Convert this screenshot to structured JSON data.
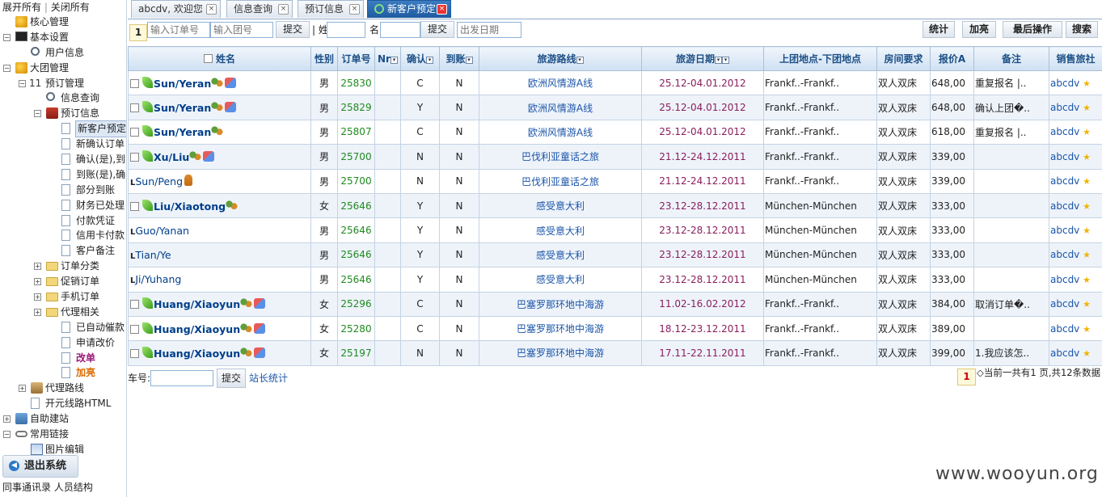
{
  "sidebar": {
    "expand_all": "展开所有",
    "collapse_all": "关闭所有",
    "tree": [
      {
        "label": "核心管理",
        "level": 0,
        "toggle": "",
        "icon": "globe-icon"
      },
      {
        "label": "基本设置",
        "level": 0,
        "toggle": "−",
        "icon": "monitor-icon"
      },
      {
        "label": "用户信息",
        "level": 1,
        "toggle": "",
        "icon": "search-icon"
      },
      {
        "label": "大团管理",
        "level": 0,
        "toggle": "−",
        "icon": "chart-icon"
      },
      {
        "label": "预订管理",
        "level": 1,
        "toggle": "−",
        "icon": "number-icon",
        "prefix": "11"
      },
      {
        "label": "信息查询",
        "level": 2,
        "toggle": "",
        "icon": "search-icon"
      },
      {
        "label": "预订信息",
        "level": 2,
        "toggle": "−",
        "icon": "book-icon"
      },
      {
        "label": "新客户预定",
        "level": 3,
        "toggle": "",
        "icon": "document-icon",
        "selected": true
      },
      {
        "label": "新确认订单",
        "level": 3,
        "toggle": "",
        "icon": "document-icon"
      },
      {
        "label": "确认(是),到",
        "level": 3,
        "toggle": "",
        "icon": "document-icon"
      },
      {
        "label": "到账(是),确",
        "level": 3,
        "toggle": "",
        "icon": "document-icon"
      },
      {
        "label": "部分到账",
        "level": 3,
        "toggle": "",
        "icon": "document-icon"
      },
      {
        "label": "财务已处理",
        "level": 3,
        "toggle": "",
        "icon": "document-icon"
      },
      {
        "label": "付款凭证",
        "level": 3,
        "toggle": "",
        "icon": "document-icon"
      },
      {
        "label": "信用卡付款",
        "level": 3,
        "toggle": "",
        "icon": "document-icon"
      },
      {
        "label": "客户备注",
        "level": 3,
        "toggle": "",
        "icon": "document-icon"
      },
      {
        "label": "订单分类",
        "level": 2,
        "toggle": "+",
        "icon": "folder-icon"
      },
      {
        "label": "促销订单",
        "level": 2,
        "toggle": "+",
        "icon": "folder-icon"
      },
      {
        "label": "手机订单",
        "level": 2,
        "toggle": "+",
        "icon": "folder-icon"
      },
      {
        "label": "代理相关",
        "level": 2,
        "toggle": "+",
        "icon": "folder-icon"
      },
      {
        "label": "已自动催款",
        "level": 3,
        "toggle": "",
        "icon": "document-icon"
      },
      {
        "label": "申请改价",
        "level": 3,
        "toggle": "",
        "icon": "document-icon"
      },
      {
        "label": "改单",
        "level": 3,
        "toggle": "",
        "icon": "document-icon",
        "color": "#9a1a7a",
        "bold": true
      },
      {
        "label": "加亮",
        "level": 3,
        "toggle": "",
        "icon": "document-icon",
        "color": "#d86a00",
        "bold": true
      },
      {
        "label": "代理路线",
        "level": 1,
        "toggle": "+",
        "icon": "bag-icon"
      },
      {
        "label": "开元线路HTML",
        "level": 1,
        "toggle": "",
        "icon": "document-icon"
      },
      {
        "label": "自助建站",
        "level": 0,
        "toggle": "+",
        "icon": "house-icon"
      },
      {
        "label": "常用链接",
        "level": 0,
        "toggle": "−",
        "icon": "link-icon"
      },
      {
        "label": "图片编辑",
        "level": 1,
        "toggle": "",
        "icon": "picture-icon"
      }
    ],
    "logout": "退出系统",
    "footer_left": "同事通讯录",
    "footer_right": "人员结构"
  },
  "tabs": [
    {
      "label": "abcdv, 欢迎您",
      "active": false
    },
    {
      "label": "信息查询",
      "active": false
    },
    {
      "label": "预订信息",
      "active": false
    },
    {
      "label": "新客户预定",
      "active": true
    }
  ],
  "toolbar": {
    "page": "1",
    "order_placeholder": "输入订单号",
    "group_placeholder": "输入团号",
    "submit1": "提交",
    "surname_label": "姓",
    "given_label": "名",
    "submit2": "提交",
    "date_placeholder": "出发日期",
    "stats": "统计",
    "highlight": "加亮",
    "last_op": "最后操作",
    "search": "搜索"
  },
  "table": {
    "headers": {
      "name": "姓名",
      "gender": "性别",
      "order_no": "订单号",
      "nr": "Nr",
      "confirm": "确认",
      "paid": "到账",
      "route": "旅游路线",
      "date": "旅游日期",
      "places": "上团地点-下团地点",
      "room": "房间要求",
      "price": "报价A",
      "note": "备注",
      "agency": "销售旅社"
    },
    "rows": [
      {
        "name": "Sun/Yeran",
        "main": true,
        "cube": true,
        "gender": "男",
        "order": "25830",
        "nr": "",
        "confirm": "C",
        "paid": "N",
        "route": "欧洲风情游A线",
        "date": "25.12-04.01.2012",
        "places": "Frankf..-Frankf..",
        "room": "双人双床",
        "price": "648,00",
        "note": "重复报名 |..",
        "agency": "abcdv"
      },
      {
        "name": "Sun/Yeran",
        "main": true,
        "cube": true,
        "gender": "男",
        "order": "25829",
        "nr": "",
        "confirm": "Y",
        "paid": "N",
        "route": "欧洲风情游A线",
        "date": "25.12-04.01.2012",
        "places": "Frankf..-Frankf..",
        "room": "双人双床",
        "price": "648,00",
        "note": "确认上团�..",
        "agency": "abcdv"
      },
      {
        "name": "Sun/Yeran",
        "main": true,
        "cube": false,
        "gender": "男",
        "order": "25807",
        "nr": "",
        "confirm": "C",
        "paid": "N",
        "route": "欧洲风情游A线",
        "date": "25.12-04.01.2012",
        "places": "Frankf..-Frankf..",
        "room": "双人双床",
        "price": "618,00",
        "note": "重复报名 |..",
        "agency": "abcdv"
      },
      {
        "name": "Xu/Liu",
        "main": true,
        "cube": true,
        "gender": "男",
        "order": "25700",
        "nr": "",
        "confirm": "N",
        "paid": "N",
        "route": "巴伐利亚童话之旅",
        "date": "21.12-24.12.2011",
        "places": "Frankf..-Frankf..",
        "room": "双人双床",
        "price": "339,00",
        "note": "",
        "agency": "abcdv"
      },
      {
        "name": "Sun/Peng",
        "main": false,
        "walk": true,
        "gender": "男",
        "order": "25700",
        "nr": "",
        "confirm": "N",
        "paid": "N",
        "route": "巴伐利亚童话之旅",
        "date": "21.12-24.12.2011",
        "places": "Frankf..-Frankf..",
        "room": "双人双床",
        "price": "339,00",
        "note": "",
        "agency": "abcdv"
      },
      {
        "name": "Liu/Xiaotong",
        "main": true,
        "cube": false,
        "gender": "女",
        "order": "25646",
        "nr": "",
        "confirm": "Y",
        "paid": "N",
        "route": "感受意大利",
        "date": "23.12-28.12.2011",
        "places": "München-München",
        "room": "双人双床",
        "price": "333,00",
        "note": "",
        "agency": "abcdv"
      },
      {
        "name": "Guo/Yanan",
        "main": false,
        "gender": "男",
        "order": "25646",
        "nr": "",
        "confirm": "Y",
        "paid": "N",
        "route": "感受意大利",
        "date": "23.12-28.12.2011",
        "places": "München-München",
        "room": "双人双床",
        "price": "333,00",
        "note": "",
        "agency": "abcdv"
      },
      {
        "name": "Tian/Ye",
        "main": false,
        "gender": "男",
        "order": "25646",
        "nr": "",
        "confirm": "Y",
        "paid": "N",
        "route": "感受意大利",
        "date": "23.12-28.12.2011",
        "places": "München-München",
        "room": "双人双床",
        "price": "333,00",
        "note": "",
        "agency": "abcdv"
      },
      {
        "name": "Ji/Yuhang",
        "main": false,
        "gender": "男",
        "order": "25646",
        "nr": "",
        "confirm": "Y",
        "paid": "N",
        "route": "感受意大利",
        "date": "23.12-28.12.2011",
        "places": "München-München",
        "room": "双人双床",
        "price": "333,00",
        "note": "",
        "agency": "abcdv"
      },
      {
        "name": "Huang/Xiaoyun",
        "main": true,
        "cube": true,
        "gender": "女",
        "order": "25296",
        "nr": "",
        "confirm": "C",
        "paid": "N",
        "route": "巴塞罗那环地中海游",
        "date": "11.02-16.02.2012",
        "places": "Frankf..-Frankf..",
        "room": "双人双床",
        "price": "384,00",
        "note": "取消订单�..",
        "agency": "abcdv"
      },
      {
        "name": "Huang/Xiaoyun",
        "main": true,
        "cube": true,
        "gender": "女",
        "order": "25280",
        "nr": "",
        "confirm": "C",
        "paid": "N",
        "route": "巴塞罗那环地中海游",
        "date": "18.12-23.12.2011",
        "places": "Frankf..-Frankf..",
        "room": "双人双床",
        "price": "389,00",
        "note": "",
        "agency": "abcdv"
      },
      {
        "name": "Huang/Xiaoyun",
        "main": true,
        "cube": true,
        "gender": "女",
        "order": "25197",
        "nr": "",
        "confirm": "N",
        "paid": "N",
        "route": "巴塞罗那环地中海游",
        "date": "17.11-22.11.2011",
        "places": "Frankf..-Frankf..",
        "room": "双人双床",
        "price": "399,00",
        "note": "1.我应该怎..",
        "agency": "abcdv"
      }
    ]
  },
  "bottom": {
    "car_label": "车号:",
    "submit": "提交",
    "station_stats": "站长统计",
    "page": "1",
    "summary": "◇当前一共有1 页,共12条数据"
  },
  "watermark": "www.wooyun.org"
}
